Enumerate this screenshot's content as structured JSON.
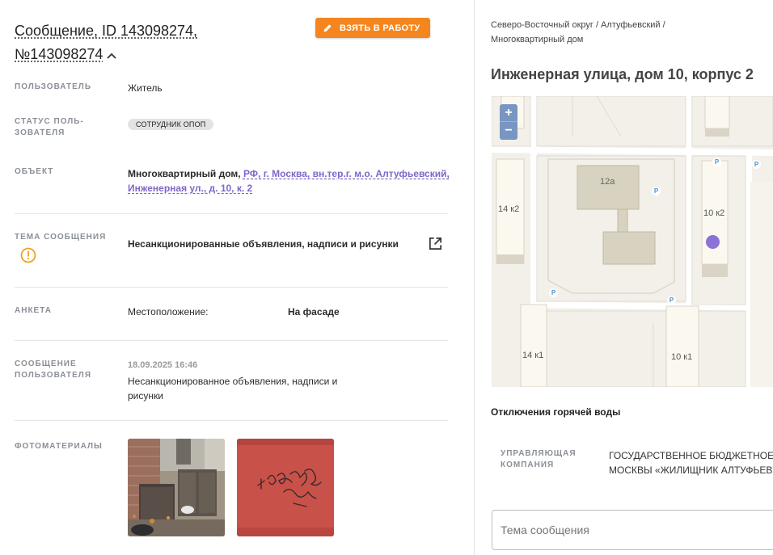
{
  "message": {
    "title_line1": "Сообщение, ID 143098274,",
    "title_line2": "№143098274",
    "take_button": "ВЗЯТЬ В РАБОТУ"
  },
  "fields": {
    "user_label": "ПОЛЬЗОВАТЕЛЬ",
    "user_value": "Житель",
    "status_label_1": "СТАТУС ПОЛЬ-",
    "status_label_2": "ЗОВАТЕЛЯ",
    "status_badge": "СОТРУДНИК ОПОП",
    "object_label": "ОБЪЕКТ",
    "object_type": "Многоквартирный дом,",
    "object_link_1": "РФ, г. Москва, вн.тер.г. м.о. Алтуфьевский,",
    "object_link_2": "Инженерная ул., д. 10, к. 2",
    "theme_label": "ТЕМА СООБЩЕНИЯ",
    "theme_value": "Несанкционированные объявления, надписи и рисунки",
    "survey_label": "АНКЕТА",
    "survey_key": "Местоположение:",
    "survey_value": "На фасаде",
    "usermsg_label_1": "СООБЩЕНИЕ",
    "usermsg_label_2": "ПОЛЬЗОВАТЕЛЯ",
    "usermsg_date": "18.09.2025 16:46",
    "usermsg_text_1": "Несанкционированное объявления, надписи и",
    "usermsg_text_2": "рисунки",
    "photos_label": "ФОТОМАТЕРИАЛЫ"
  },
  "right": {
    "breadcrumb_1": "Северо-Восточный округ / Алтуфьевский /",
    "breadcrumb_2": "Многоквартирный дом",
    "address": "Инженерная улица, дом 10, корпус 2",
    "map": {
      "zoom_in": "+",
      "zoom_out": "−",
      "labels": [
        "12а",
        "14 к2",
        "10 к2",
        "14 к1",
        "10 к1"
      ],
      "parking": "P"
    },
    "hot_water": "Отключения горячей воды",
    "mc_label_1": "УПРАВЛЯЮЩАЯ",
    "mc_label_2": "КОМПАНИЯ",
    "mc_value_1": "ГОСУДАРСТВЕННОЕ БЮДЖЕТНОЕ У",
    "mc_value_2": "МОСКВЫ «ЖИЛИЩНИК АЛТУФЬЕВ",
    "theme_placeholder": "Тема сообщения"
  },
  "colors": {
    "accent_orange": "#f5861f",
    "link_purple": "#7e67c8",
    "marker": "#8a72d6",
    "zoom_blue": "#7996c2"
  },
  "icons": [
    "pencil-icon",
    "chevron-up-icon",
    "warning-icon",
    "external-link-icon",
    "parking-icon"
  ]
}
